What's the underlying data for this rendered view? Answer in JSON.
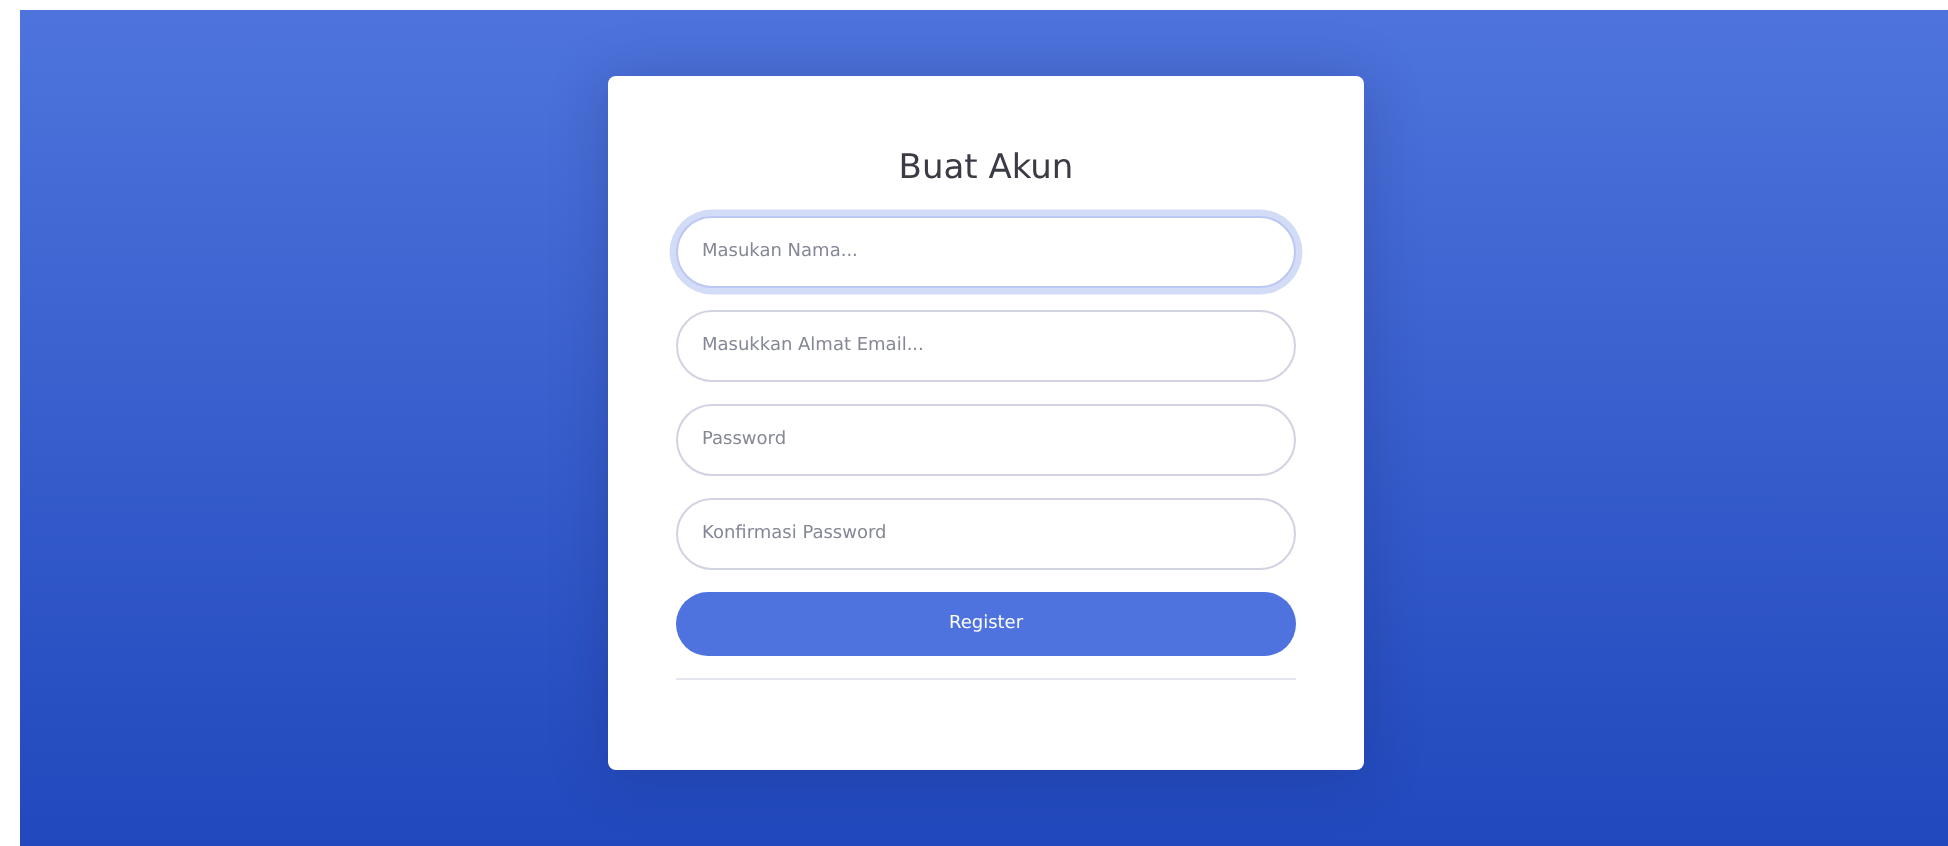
{
  "title": "Buat Akun",
  "fields": [
    {
      "placeholder": "Masukan Nama...",
      "focused": true
    },
    {
      "placeholder": "Masukkan Almat Email...",
      "focused": false
    },
    {
      "placeholder": "Password",
      "focused": false
    },
    {
      "placeholder": "Konfirmasi Password",
      "focused": false
    }
  ],
  "button": "Register"
}
